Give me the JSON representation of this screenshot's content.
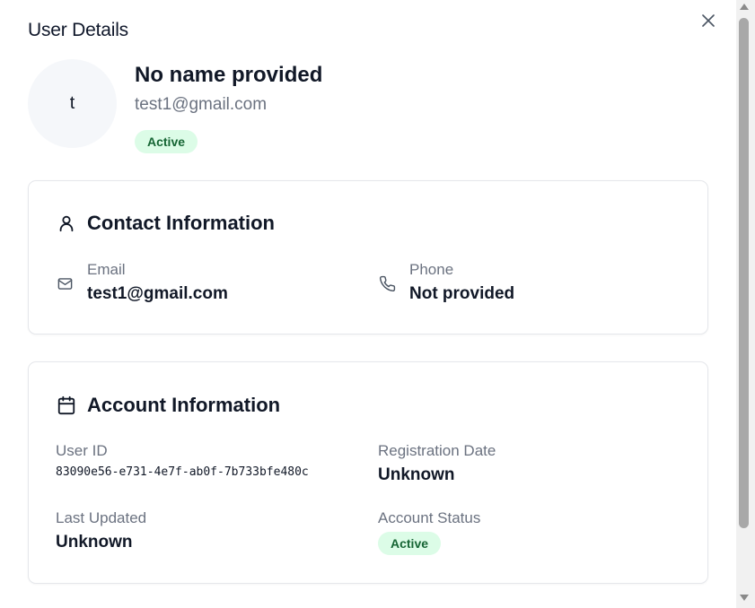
{
  "dialog": {
    "title": "User Details",
    "close_icon": "close-icon"
  },
  "profile": {
    "avatar_initial": "t",
    "name": "No name provided",
    "email": "test1@gmail.com",
    "status": "Active"
  },
  "contact": {
    "title": "Contact Information",
    "icon": "user-icon",
    "email_label": "Email",
    "email_value": "test1@gmail.com",
    "email_icon": "mail-icon",
    "phone_label": "Phone",
    "phone_value": "Not provided",
    "phone_icon": "phone-icon"
  },
  "account": {
    "title": "Account Information",
    "icon": "calendar-icon",
    "user_id_label": "User ID",
    "user_id_value": "83090e56-e731-4e7f-ab0f-7b733bfe480c",
    "registration_label": "Registration Date",
    "registration_value": "Unknown",
    "updated_label": "Last Updated",
    "updated_value": "Unknown",
    "status_label": "Account Status",
    "status_value": "Active"
  },
  "colors": {
    "badge_bg": "#dcfce7",
    "badge_text": "#166534",
    "muted_text": "#6b7280",
    "card_border": "#e5e7eb"
  }
}
